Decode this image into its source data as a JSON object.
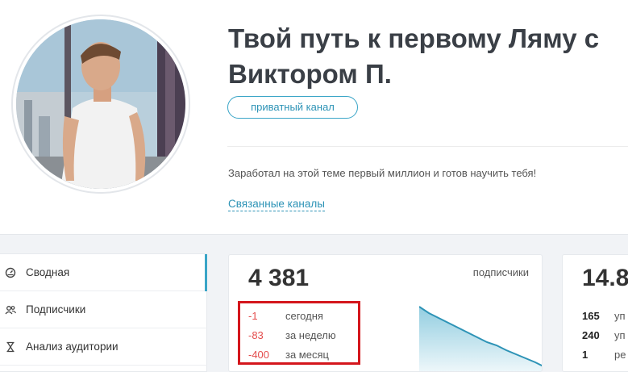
{
  "channel": {
    "title_line1": "Твой путь к первому Ляму с",
    "title_line2": "Виктором П.",
    "badge": "приватный канал",
    "description": "Заработал на этой теме первый миллион и готов научить тебя!",
    "related_link": "Связанные каналы"
  },
  "sidebar": {
    "items": [
      {
        "label": "Сводная",
        "icon": "dashboard-icon",
        "active": true
      },
      {
        "label": "Подписчики",
        "icon": "users-icon",
        "active": false
      },
      {
        "label": "Анализ аудитории",
        "icon": "hourglass-icon",
        "active": false
      }
    ]
  },
  "subscribers_card": {
    "value": "4 381",
    "label": "подписчики",
    "deltas": [
      {
        "value": "-1",
        "label": "сегодня"
      },
      {
        "value": "-83",
        "label": "за неделю"
      },
      {
        "value": "-400",
        "label": "за месяц"
      }
    ]
  },
  "second_card": {
    "value": "14.8",
    "rows": [
      {
        "value": "165",
        "label": "уп"
      },
      {
        "value": "240",
        "label": "уп"
      },
      {
        "value": "1",
        "label": "ре"
      }
    ]
  },
  "colors": {
    "accent": "#3aa5c7",
    "negative": "#e44d4d",
    "highlight_border": "#d4161c"
  }
}
